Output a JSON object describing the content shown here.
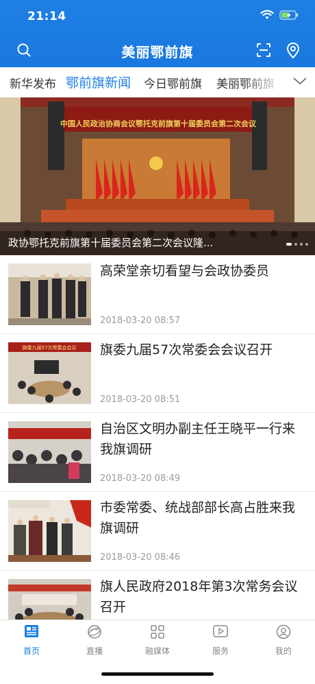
{
  "status": {
    "time": "21:14"
  },
  "header": {
    "title": "美丽鄂前旗"
  },
  "tabs": [
    "新华发布",
    "鄂前旗新闻",
    "今日鄂前旗",
    "美丽鄂前旗"
  ],
  "banner": {
    "caption": "政协鄂托克前旗第十届委员会第二次会议隆...",
    "stage_text": "中国人民政治协商会议鄂托克前旗第十届委员会第二次会议"
  },
  "news": [
    {
      "title": "高荣堂亲切看望与会政协委员",
      "time": "2018-03-20 08:57"
    },
    {
      "title": "旗委九届57次常委会会议召开",
      "time": "2018-03-20 08:51"
    },
    {
      "title": "自治区文明办副主任王晓平一行来我旗调研",
      "time": "2018-03-20 08:49"
    },
    {
      "title": "市委常委、统战部部长高占胜来我旗调研",
      "time": "2018-03-20 08:46"
    },
    {
      "title": "旗人民政府2018年第3次常务会议召开",
      "time": ""
    }
  ],
  "thumb_texts": {
    "meeting": "旗委九届57次常委会会议"
  },
  "bottom_tabs": [
    "首页",
    "直播",
    "融媒体",
    "服务",
    "我的"
  ],
  "colors": {
    "accent": "#1f7fe3",
    "muted": "#9a9a9a"
  }
}
